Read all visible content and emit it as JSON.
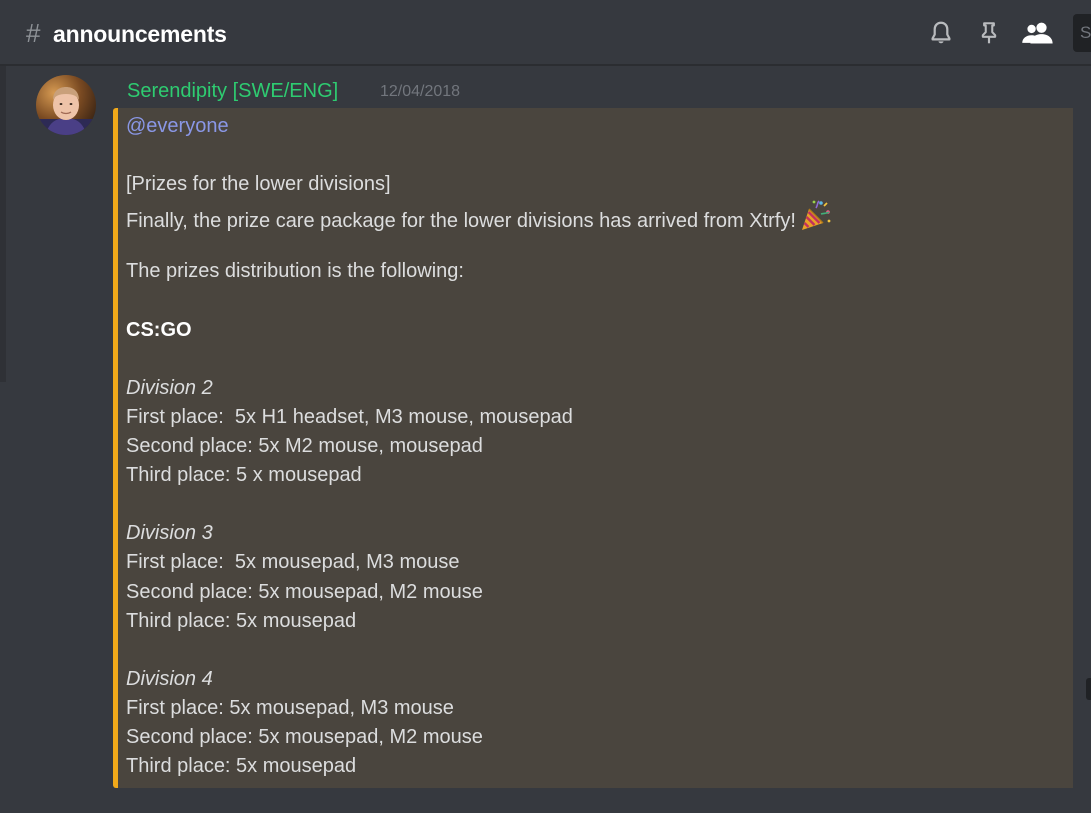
{
  "header": {
    "hash": "#",
    "channel_name": "announcements",
    "search_placeholder": "S",
    "icons": [
      "bell-icon",
      "pin-icon",
      "members-icon"
    ]
  },
  "message": {
    "author": "Serendipity [SWE/ENG]",
    "author_color": "#2ecc71",
    "timestamp": "12/04/2018",
    "embed_color": "#f1a91a",
    "mention": "@everyone",
    "lines": {
      "l2": "[Prizes for the lower divisions]",
      "l3": "Finally, the prize care package for the lower divisions has arrived from Xtrfy!",
      "l5": "The prizes distribution is the following:",
      "l7": "CS:GO",
      "l9": "Division 2",
      "l10": "First place:  5x H1 headset, M3 mouse, mousepad",
      "l11": "Second place: 5x M2 mouse, mousepad",
      "l12": "Third place: 5 x mousepad",
      "l14": "Division 3",
      "l15": "First place:  5x mousepad, M3 mouse",
      "l16": "Second place: 5x mousepad, M2 mouse",
      "l17": "Third place: 5x mousepad",
      "l19": "Division 4",
      "l20": "First place: 5x mousepad, M3 mouse",
      "l21": "Second place: 5x mousepad, M2 mouse",
      "l22": "Third place: 5x mousepad"
    },
    "emoji": "party-popper-icon"
  }
}
